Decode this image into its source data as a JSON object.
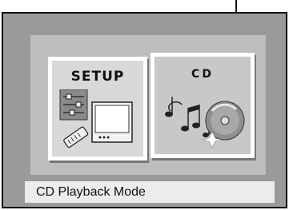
{
  "menu": {
    "items": [
      {
        "label": "SETUP",
        "icon": "settings-tv-remote-icon"
      },
      {
        "label": "CD",
        "icon": "music-disc-icon"
      }
    ],
    "selected_label": "CD"
  },
  "status": {
    "text": "CD Playback Mode"
  }
}
